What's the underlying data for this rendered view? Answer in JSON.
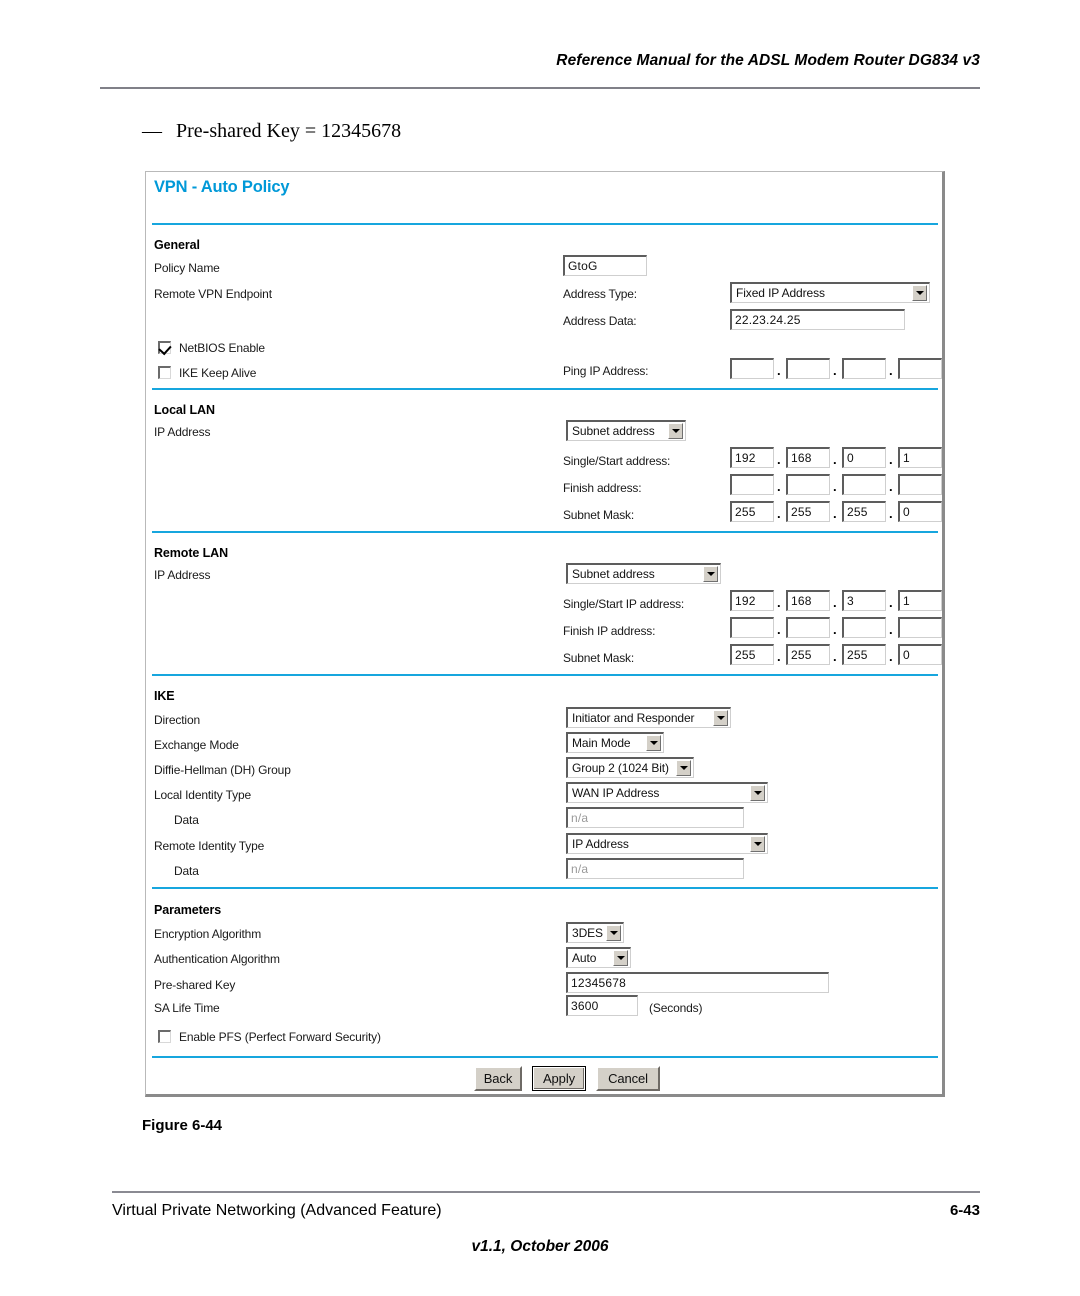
{
  "document": {
    "header_title": "Reference Manual for the ADSL Modem Router DG834 v3",
    "bullet_dash": "—",
    "bullet_text": "Pre-shared Key = 12345678",
    "figure_caption": "Figure 6-44",
    "footer_left": "Virtual Private Networking (Advanced Feature)",
    "footer_page": "6-43",
    "footer_center": "v1.1, October 2006"
  },
  "colors": {
    "title_blue": "#0099d8",
    "divider_blue": "#17a6de",
    "rule_gray": "#808088",
    "button_face": "#d4d0c8"
  },
  "panel": {
    "title": "VPN - Auto Policy",
    "sections": {
      "general": {
        "heading": "General",
        "policy_name_label": "Policy Name",
        "policy_name_value": "GtoG",
        "remote_endpoint_label": "Remote VPN Endpoint",
        "address_type_label": "Address Type:",
        "address_type_value": "Fixed IP Address",
        "address_data_label": "Address Data:",
        "address_data_value": "22.23.24.25",
        "netbios_label": "NetBIOS Enable",
        "netbios_checked": true,
        "ike_keepalive_label": "IKE Keep Alive",
        "ike_keepalive_checked": false,
        "ping_ip_label": "Ping IP Address:",
        "ping_ip_octets": [
          "",
          "",
          "",
          ""
        ]
      },
      "local_lan": {
        "heading": "Local LAN",
        "ip_address_label": "IP Address",
        "ip_address_mode": "Subnet address",
        "start_label": "Single/Start address:",
        "start_octets": [
          "192",
          "168",
          "0",
          "1"
        ],
        "finish_label": "Finish address:",
        "finish_octets": [
          "",
          "",
          "",
          ""
        ],
        "mask_label": "Subnet Mask:",
        "mask_octets": [
          "255",
          "255",
          "255",
          "0"
        ]
      },
      "remote_lan": {
        "heading": "Remote LAN",
        "ip_address_label": "IP Address",
        "ip_address_mode": "Subnet address",
        "start_label": "Single/Start IP address:",
        "start_octets": [
          "192",
          "168",
          "3",
          "1"
        ],
        "finish_label": "Finish IP address:",
        "finish_octets": [
          "",
          "",
          "",
          ""
        ],
        "mask_label": "Subnet Mask:",
        "mask_octets": [
          "255",
          "255",
          "255",
          "0"
        ]
      },
      "ike": {
        "heading": "IKE",
        "direction_label": "Direction",
        "direction_value": "Initiator and Responder",
        "exchange_mode_label": "Exchange Mode",
        "exchange_mode_value": "Main Mode",
        "dh_group_label": "Diffie-Hellman (DH) Group",
        "dh_group_value": "Group 2 (1024 Bit)",
        "local_identity_label": "Local Identity Type",
        "local_identity_value": "WAN IP Address",
        "local_data_label": "Data",
        "local_data_value": "n/a",
        "remote_identity_label": "Remote Identity Type",
        "remote_identity_value": "IP Address",
        "remote_data_label": "Data",
        "remote_data_value": "n/a"
      },
      "parameters": {
        "heading": "Parameters",
        "encryption_label": "Encryption Algorithm",
        "encryption_value": "3DES",
        "authentication_label": "Authentication Algorithm",
        "authentication_value": "Auto",
        "preshared_key_label": "Pre-shared Key",
        "preshared_key_value": "12345678",
        "sa_life_label": "SA Life Time",
        "sa_life_value": "3600",
        "sa_life_units": "(Seconds)",
        "pfs_label": "Enable PFS (Perfect Forward Security)",
        "pfs_checked": false
      }
    },
    "buttons": {
      "back": "Back",
      "apply": "Apply",
      "cancel": "Cancel"
    }
  }
}
